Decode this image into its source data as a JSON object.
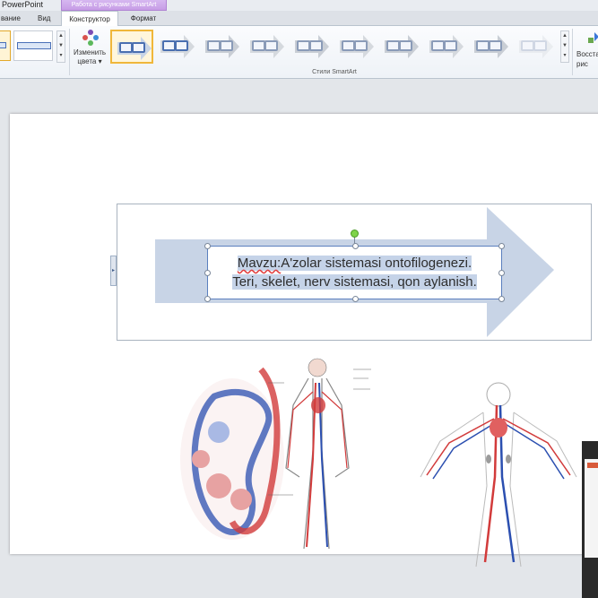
{
  "titlebar": {
    "app_title": "PowerPoint",
    "context_tab_group": "Работа с рисунками SmartArt"
  },
  "tabs": [
    {
      "label": "вание"
    },
    {
      "label": "Вид"
    },
    {
      "label": "Конструктор",
      "active": true
    },
    {
      "label": "Формат"
    }
  ],
  "ribbon": {
    "change_colors_label_1": "Изменить",
    "change_colors_label_2": "цвета",
    "styles_group_label": "Стили SmartArt",
    "reset_label_1": "Восста",
    "reset_label_2": "рис",
    "style_count": 10,
    "selected_style_index": 0
  },
  "slide": {
    "topic_prefix": "Mavzu:",
    "topic_line1_rest": "A'zolar sistemasi ontofilogenezi.",
    "topic_line2": "Teri, skelet, nerv sistemasi, qon aylanish."
  },
  "colors": {
    "accent_selected": "#f0b73a",
    "arrow_fill": "#c8d4e6",
    "shape_border": "#5b7fbe",
    "artery_red": "#d23b3b",
    "vein_blue": "#2b4fb0"
  }
}
